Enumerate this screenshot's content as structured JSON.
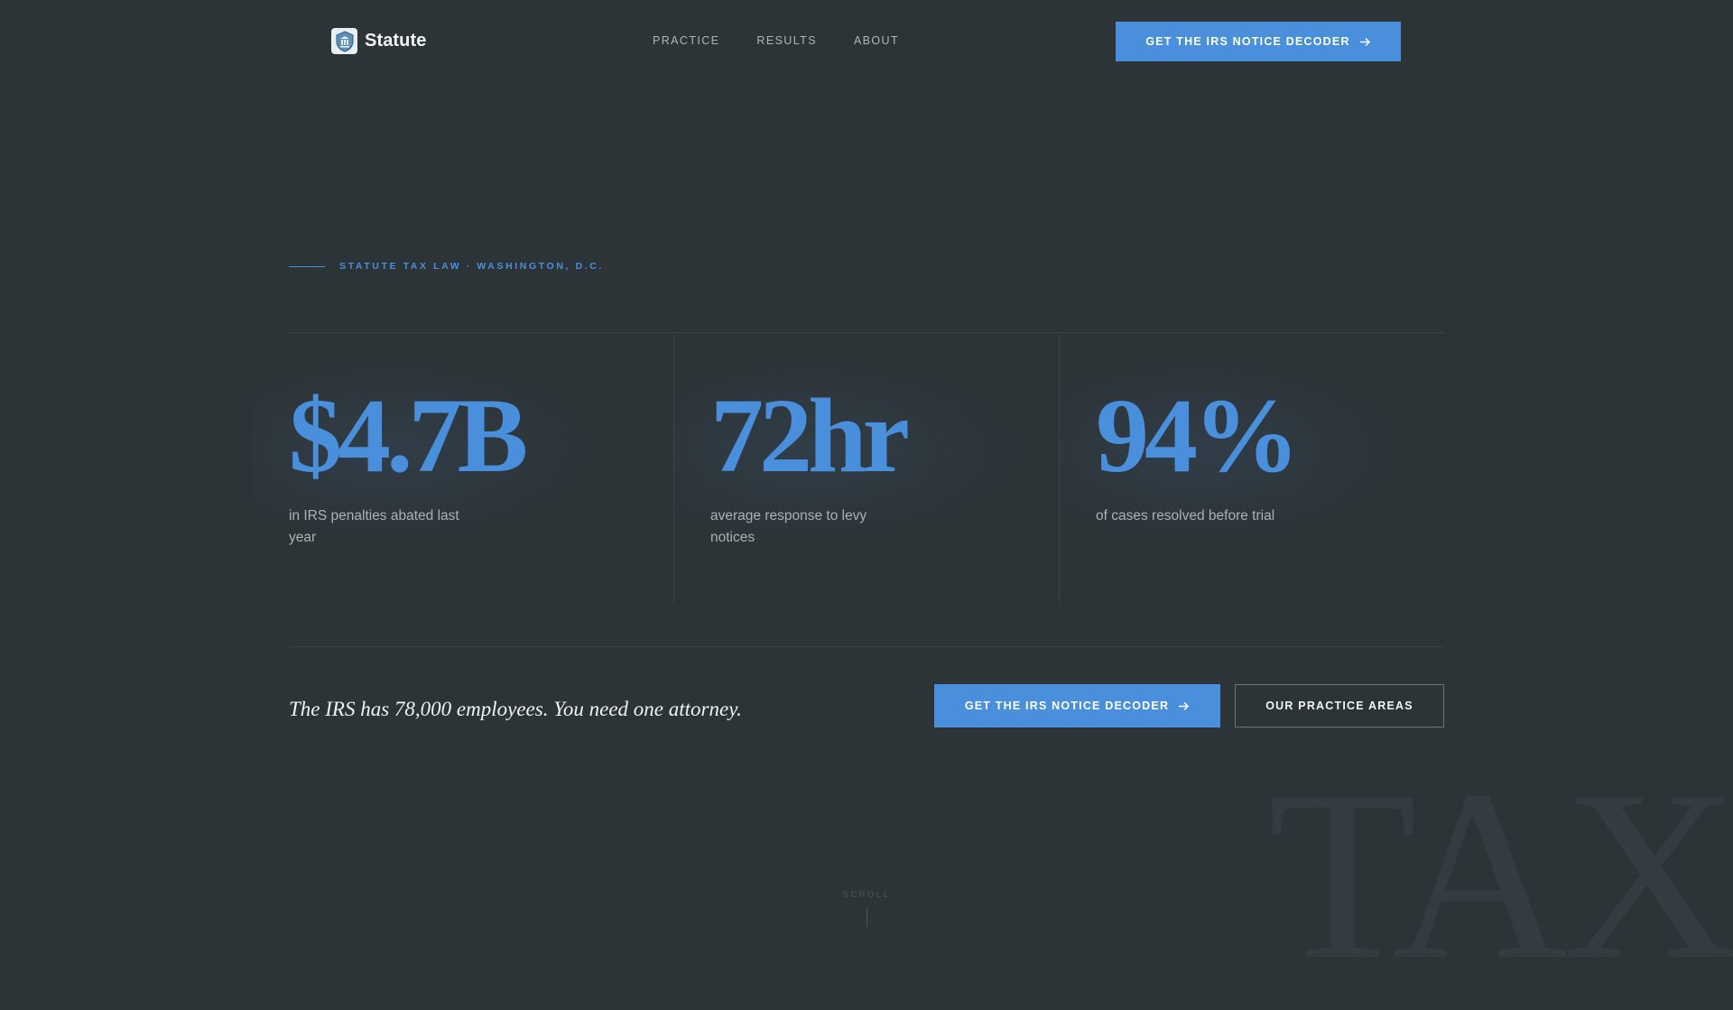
{
  "brand": {
    "name": "Statute",
    "logo_icon": "building-shield-icon"
  },
  "nav": {
    "items": [
      {
        "label": "PRACTICE"
      },
      {
        "label": "RESULTS"
      },
      {
        "label": "ABOUT"
      }
    ]
  },
  "header": {
    "cta_label": "GET THE IRS NOTICE DECODER",
    "cta_icon": "arrow-right-icon"
  },
  "hero": {
    "eyebrow": "STATUTE TAX LAW · WASHINGTON, D.C.",
    "stats": [
      {
        "value": "$4.7B",
        "caption": "in IRS penalties abated last year"
      },
      {
        "value": "72hr",
        "caption": "average response to levy notices"
      },
      {
        "value": "94%",
        "caption": "of cases resolved before trial"
      }
    ],
    "tagline": "The IRS has 78,000 employees. You need one attorney.",
    "primary_cta": "GET THE IRS NOTICE DECODER",
    "secondary_cta": "OUR PRACTICE AREAS"
  },
  "scroll": {
    "label": "SCROLL"
  },
  "watermark": "TAX",
  "colors": {
    "background": "#2d3438",
    "accent": "#4a8fdb",
    "muted_text": "#aab2b9"
  }
}
